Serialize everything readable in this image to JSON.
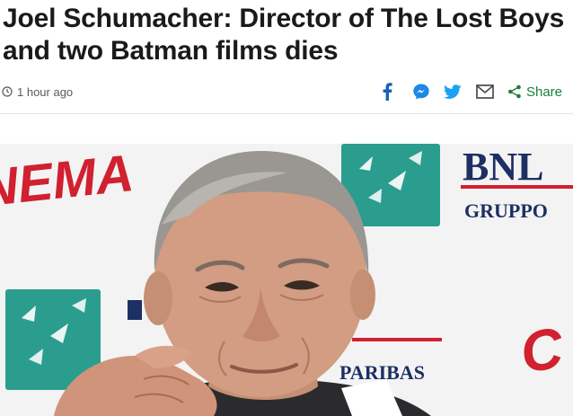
{
  "article": {
    "headline": "Joel Schumacher: Director of The Lost Boys and two Batman films dies",
    "timestamp": "1 hour ago"
  },
  "share_bar": {
    "icons": [
      "facebook-icon",
      "messenger-icon",
      "twitter-icon",
      "email-icon",
      "share-icon"
    ],
    "share_label": "Share",
    "colors": {
      "facebook": "#1c5fb7",
      "messenger": "#1e88e5",
      "twitter": "#1da1f2",
      "email": "#404040",
      "share": "#1b7f3b"
    }
  },
  "hero_image": {
    "backdrop_text": {
      "festival_word": "NEMA",
      "sponsor": "BNL",
      "sponsor_group": "GRUPPO",
      "bottom_word": "PARIBAS",
      "red_fragment": "C"
    },
    "colors": {
      "backdrop": "#f3f3f3",
      "teal_logo": "#2a9d8f",
      "red_text": "#d1202f",
      "navy_text": "#1d2f63"
    }
  }
}
